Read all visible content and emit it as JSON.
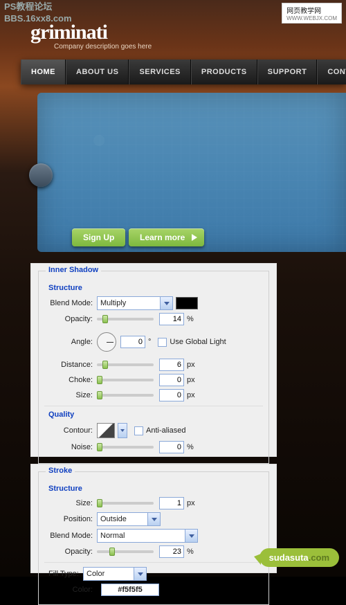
{
  "watermark": {
    "line1": "PS教程论坛",
    "line2": "BBS.16xx8.com",
    "right1": "网页教学网",
    "right2": "WWW.WEBJX.COM"
  },
  "logo": "griminati",
  "tagline": "Company description goes here",
  "nav": [
    "HOME",
    "ABOUT US",
    "SERVICES",
    "PRODUCTS",
    "SUPPORT",
    "CONTACT"
  ],
  "buttons": {
    "signup": "Sign Up",
    "learn": "Learn more"
  },
  "panel1": {
    "title": "Inner Shadow",
    "structure": "Structure",
    "blendMode": {
      "label": "Blend Mode:",
      "value": "Multiply"
    },
    "opacity": {
      "label": "Opacity:",
      "value": "14",
      "unit": "%"
    },
    "angle": {
      "label": "Angle:",
      "value": "0",
      "unit": "°",
      "globalLabel": "Use Global Light"
    },
    "distance": {
      "label": "Distance:",
      "value": "6",
      "unit": "px"
    },
    "choke": {
      "label": "Choke:",
      "value": "0",
      "unit": "px"
    },
    "size": {
      "label": "Size:",
      "value": "0",
      "unit": "px"
    },
    "quality": "Quality",
    "contour": {
      "label": "Contour:",
      "antiAliased": "Anti-aliased"
    },
    "noise": {
      "label": "Noise:",
      "value": "0",
      "unit": "%"
    }
  },
  "panel2": {
    "title": "Stroke",
    "structure": "Structure",
    "size": {
      "label": "Size:",
      "value": "1",
      "unit": "px"
    },
    "position": {
      "label": "Position:",
      "value": "Outside"
    },
    "blendMode": {
      "label": "Blend Mode:",
      "value": "Normal"
    },
    "opacity": {
      "label": "Opacity:",
      "value": "23",
      "unit": "%"
    },
    "fillType": {
      "label": "Fill Type:",
      "value": "Color"
    },
    "color": {
      "label": "Color:",
      "value": "#f5f5f5"
    }
  },
  "bubble": {
    "a": "sudasuta",
    "b": ".com"
  }
}
